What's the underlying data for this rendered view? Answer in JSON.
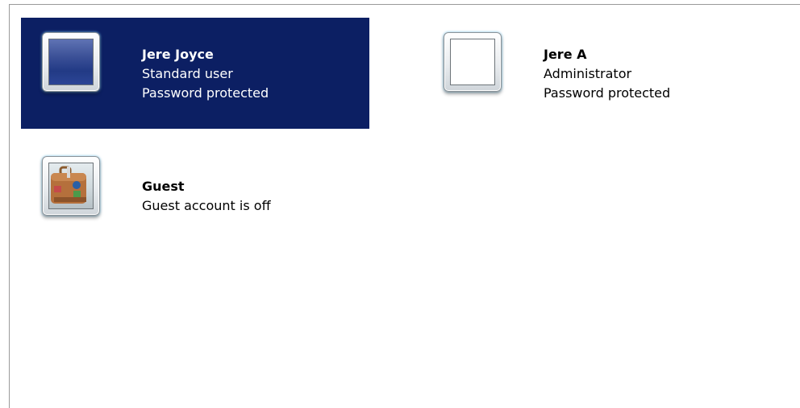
{
  "accounts": [
    {
      "name": "Jere Joyce",
      "type": "Standard user",
      "status": "Password protected",
      "selected": true,
      "picture": "blue-square-picture"
    },
    {
      "name": "Jere A",
      "type": "Administrator",
      "status": "Password protected",
      "selected": false,
      "picture": "blank-picture"
    },
    {
      "name": "Guest",
      "type": "Guest account is off",
      "status": "",
      "selected": false,
      "picture": "suitcase-picture"
    }
  ],
  "colors": {
    "selection": "#0c1f63",
    "frame_glow": "#7fc6e8"
  }
}
